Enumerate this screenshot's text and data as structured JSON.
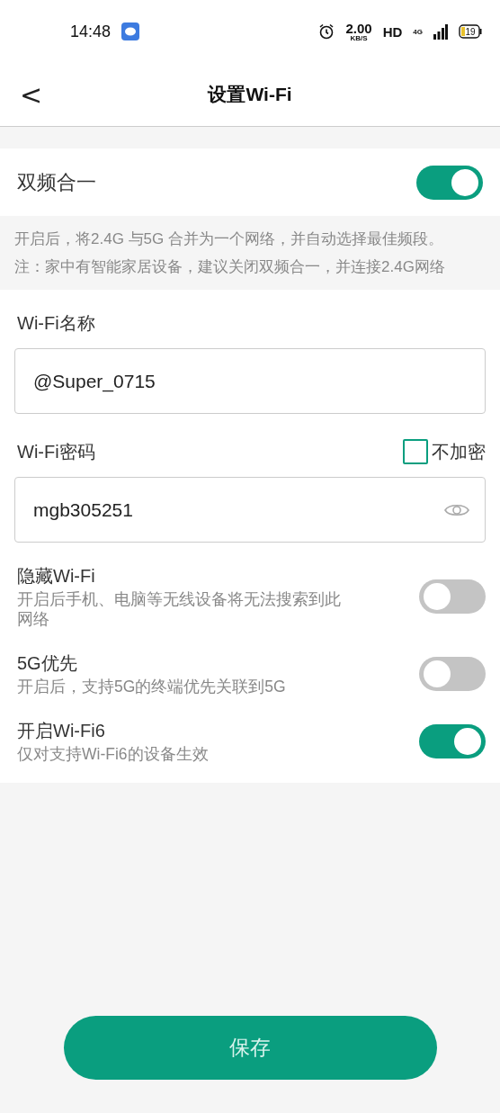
{
  "status_bar": {
    "time": "14:48",
    "speed": "2.00",
    "speed_unit": "KB/S",
    "hd": "HD",
    "network": "4G",
    "battery": "19"
  },
  "header": {
    "back": "<",
    "title": "设置Wi-Fi"
  },
  "dual_band": {
    "label": "双频合一",
    "on": true
  },
  "dual_band_note": [
    "开启后，将2.4G 与5G 合并为一个网络，并自动选择最佳频段。",
    "注：家中有智能家居设备，建议关闭双频合一，并连接2.4G网络"
  ],
  "wifi_name": {
    "label": "Wi-Fi名称",
    "value": "@Super_0715"
  },
  "wifi_password": {
    "label": "Wi-Fi密码",
    "no_encryption": {
      "label": "不加密",
      "checked": false
    },
    "value": "mgb305251"
  },
  "options": [
    {
      "title": "隐藏Wi-Fi",
      "description": "开启后手机、电脑等无线设备将无法搜索到此网络",
      "on": false
    },
    {
      "title": "5G优先",
      "description": "开启后，支持5G的终端优先关联到5G",
      "on": false
    },
    {
      "title": "开启Wi-Fi6",
      "description": "仅对支持Wi-Fi6的设备生效",
      "on": true
    }
  ],
  "save_button": "保存"
}
